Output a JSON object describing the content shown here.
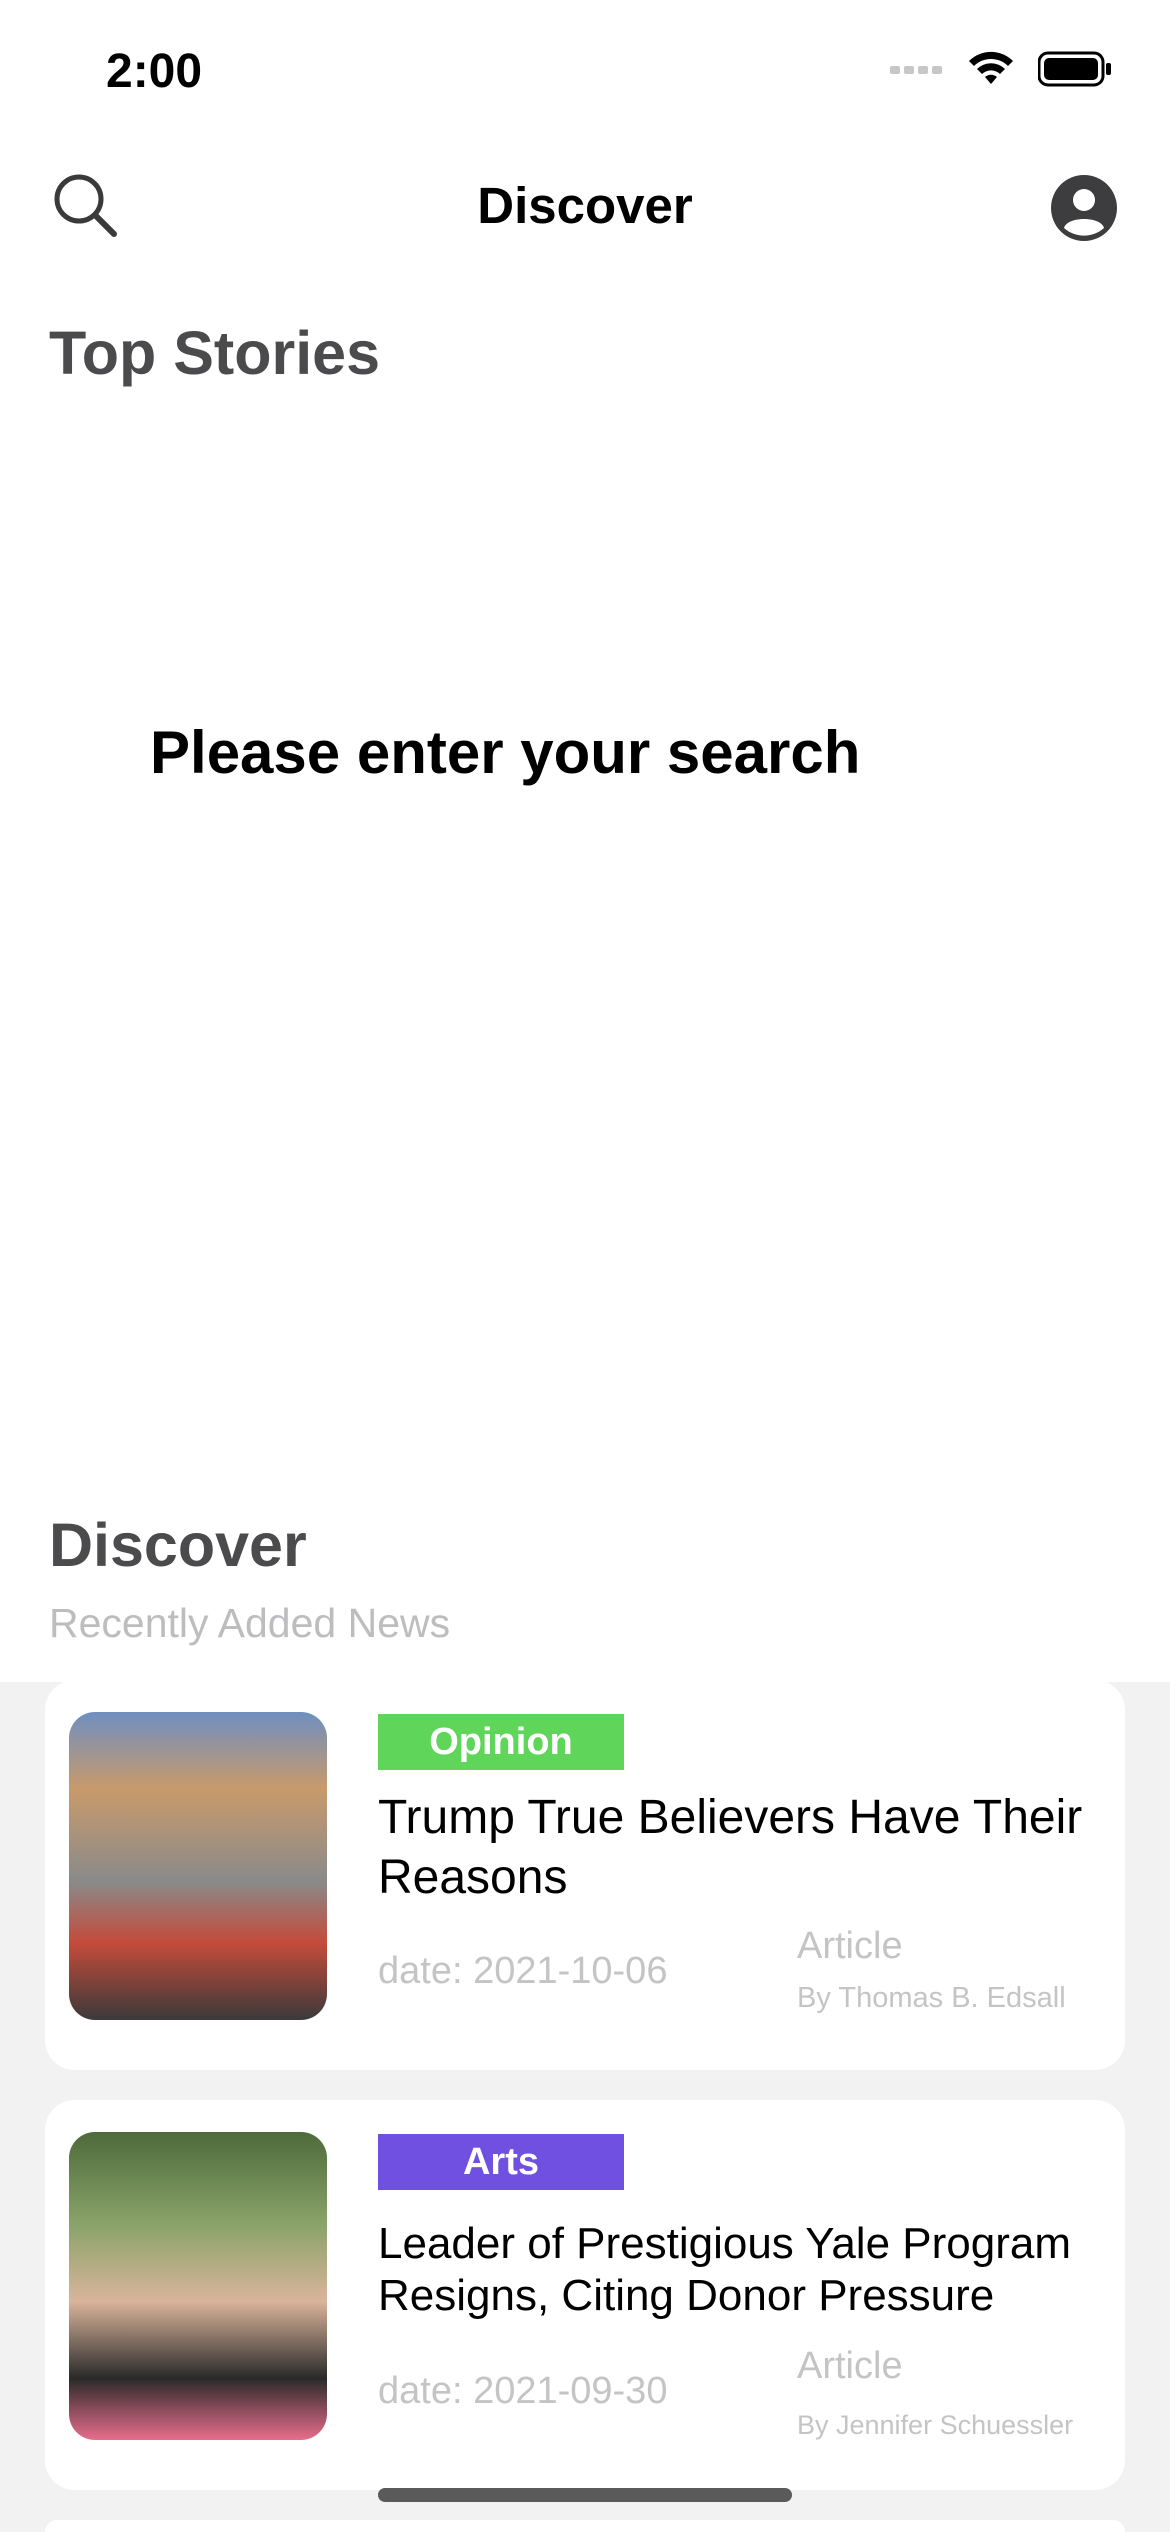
{
  "status_bar": {
    "time": "2:00"
  },
  "nav": {
    "title": "Discover"
  },
  "top_stories": {
    "title": "Top Stories",
    "empty_message": "Please enter your search"
  },
  "discover": {
    "title": "Discover",
    "subtitle": "Recently Added News"
  },
  "articles": [
    {
      "category": "Opinion",
      "category_color": "#5fd659",
      "title": "Trump True Believers Have Their Reasons",
      "date": "date: 2021-10-06",
      "type": "Article",
      "author": "By Thomas B. Edsall"
    },
    {
      "category": "Arts",
      "category_color": "#6f50e0",
      "title": "Leader of Prestigious Yale Program Resigns, Citing Donor Pressure",
      "date": "date: 2021-09-30",
      "type": "Article",
      "author": "By Jennifer Schuessler"
    }
  ],
  "icons": {
    "search": "search-icon",
    "profile": "profile-icon",
    "signal": "cellular-signal-icon",
    "wifi": "wifi-icon",
    "battery": "battery-icon"
  }
}
